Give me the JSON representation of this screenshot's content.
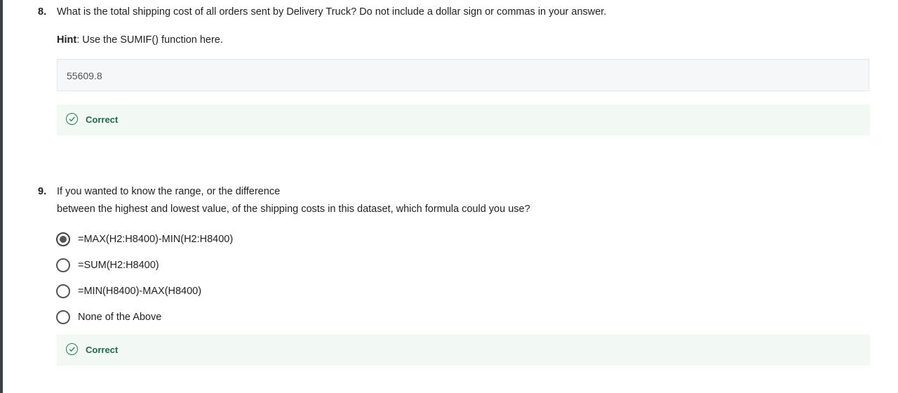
{
  "question8": {
    "number": "8.",
    "text": "What is the total shipping cost of all orders sent by Delivery Truck? Do not include a dollar sign or commas in your answer.",
    "hint_label": "Hint",
    "hint_text": ": Use the SUMIF() function here.",
    "answer_value": "55609.8",
    "feedback": "Correct"
  },
  "question9": {
    "number": "9.",
    "text_line1": "If you wanted to know the range, or the difference",
    "text_line2": "between the highest and lowest value, of the shipping costs in this dataset, which formula could you use?",
    "options": [
      {
        "label": "=MAX(H2:H8400)-MIN(H2:H8400)",
        "selected": true
      },
      {
        "label": "=SUM(H2:H8400)",
        "selected": false
      },
      {
        "label": "=MIN(H8400)-MAX(H8400)",
        "selected": false
      },
      {
        "label": "None of the Above",
        "selected": false
      }
    ],
    "feedback": "Correct"
  },
  "colors": {
    "correct_green": "#1f8354",
    "feedback_bg": "#f2f8f4",
    "answer_bg": "#f5f7f8"
  },
  "icons": {
    "feedback_icon": "check-circle-icon"
  }
}
